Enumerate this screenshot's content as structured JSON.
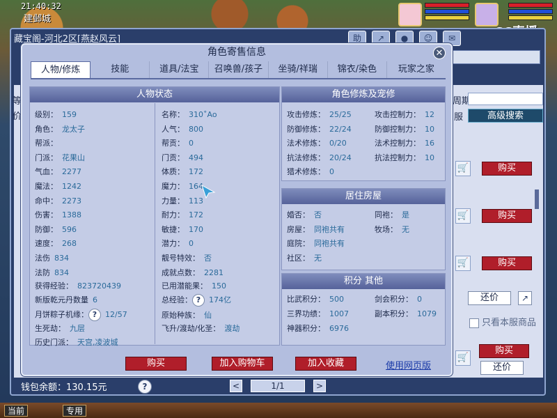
{
  "hud": {
    "time": "21:40:32",
    "city": "建邺城",
    "stream_logo": "CC直播"
  },
  "back_window": {
    "title": "藏宝阁-河北2区[燕赵风云]",
    "tools": [
      "助",
      "↗",
      "●",
      "☺",
      "✉"
    ],
    "labels": {
      "left_a": "等",
      "left_b": "价",
      "period": "周期",
      "server": "服"
    },
    "advanced_search": "高级搜索",
    "buy_label": "购买",
    "haggle_label": "还价",
    "only_this_server": "只看本服商品",
    "wallet_label": "钱包余额：",
    "wallet_value": "130.15元",
    "page": "1/1",
    "prev": "<",
    "next": ">"
  },
  "taskbar": {
    "current": "当前",
    "exclusive": "专用"
  },
  "dialog": {
    "title": "角色寄售信息",
    "close": "✕",
    "tabs": [
      "人物/修炼",
      "技能",
      "道具/法宝",
      "召唤兽/孩子",
      "坐骑/祥瑞",
      "锦衣/染色",
      "玩家之家"
    ],
    "active_tab": "人物/修炼",
    "status": {
      "header": "人物状态",
      "left": [
        {
          "label": "级别：",
          "value": "159"
        },
        {
          "label": "角色：",
          "value": "龙太子"
        },
        {
          "label": "帮派：",
          "value": ""
        },
        {
          "label": "门派：",
          "value": "花果山"
        },
        {
          "label": "气血：",
          "value": "2277"
        },
        {
          "label": "魔法：",
          "value": "1242"
        },
        {
          "label": "命中：",
          "value": "2273"
        },
        {
          "label": "伤害：",
          "value": "1388"
        },
        {
          "label": "防御：",
          "value": "596"
        },
        {
          "label": "速度：",
          "value": "268"
        },
        {
          "label": "法伤",
          "value": "834"
        },
        {
          "label": "法防",
          "value": "834"
        }
      ],
      "right": [
        {
          "label": "名称：",
          "value": "310˚Ao"
        },
        {
          "label": "人气：",
          "value": "800"
        },
        {
          "label": "帮贡：",
          "value": "0"
        },
        {
          "label": "门贡：",
          "value": "494"
        },
        {
          "label": "体质：",
          "value": "172"
        },
        {
          "label": "魔力：",
          "value": "164"
        },
        {
          "label": "力量：",
          "value": "113"
        },
        {
          "label": "耐力：",
          "value": "172"
        },
        {
          "label": "敏捷：",
          "value": "170"
        },
        {
          "label": "潜力：",
          "value": "0"
        },
        {
          "label": "靓号特效：",
          "value": "否"
        },
        {
          "label": "成就点数：",
          "value": "2281"
        }
      ],
      "extra": [
        {
          "label": "获得经验：",
          "value": "823720439"
        },
        {
          "label": "已用潜能果：",
          "value": "150"
        },
        {
          "label": "新版乾元丹数量",
          "value": "6"
        },
        {
          "label": "总经验：",
          "value": "174亿"
        },
        {
          "label": "月饼粽子机缘：",
          "value": "12/57"
        },
        {
          "label": "原始种族：",
          "value": "仙"
        },
        {
          "label": "生死劫：",
          "value": "九层"
        },
        {
          "label": "飞升/渡劫/化圣：",
          "value": "渡劫"
        },
        {
          "label": "历史门派：",
          "value": "天宫,凌波城"
        }
      ]
    },
    "cultivation": {
      "header": "角色修炼及宠修",
      "rows": [
        {
          "l_label": "攻击修炼：",
          "l_value": "25/25",
          "r_label": "攻击控制力：",
          "r_value": "12"
        },
        {
          "l_label": "防御修炼：",
          "l_value": "22/24",
          "r_label": "防御控制力：",
          "r_value": "10"
        },
        {
          "l_label": "法术修炼：",
          "l_value": "0/20",
          "r_label": "法术控制力：",
          "r_value": "16"
        },
        {
          "l_label": "抗法修炼：",
          "l_value": "20/24",
          "r_label": "抗法控制力：",
          "r_value": "10"
        },
        {
          "l_label": "猎术修炼：",
          "l_value": "0",
          "r_label": "",
          "r_value": ""
        }
      ]
    },
    "housing": {
      "header": "居住房屋",
      "rows": [
        {
          "l_label": "婚否：",
          "l_value": "否",
          "r_label": "同袍：",
          "r_value": "是"
        },
        {
          "l_label": "房屋：",
          "l_value": "同袍共有",
          "r_label": "牧场：",
          "r_value": "无"
        },
        {
          "l_label": "庭院：",
          "l_value": "同袍共有",
          "r_label": "",
          "r_value": ""
        },
        {
          "l_label": "社区：",
          "l_value": "无",
          "r_label": "",
          "r_value": ""
        }
      ]
    },
    "points": {
      "header": "积分 其他",
      "rows": [
        {
          "l_label": "比武积分：",
          "l_value": "500",
          "r_label": "剑会积分：",
          "r_value": "0"
        },
        {
          "l_label": "三界功绩：",
          "l_value": "1007",
          "r_label": "副本积分：",
          "r_value": "1079"
        },
        {
          "l_label": "神器积分：",
          "l_value": "6976",
          "r_label": "",
          "r_value": ""
        }
      ]
    },
    "actions": {
      "buy": "购买",
      "add_cart": "加入购物车",
      "add_fav": "加入收藏",
      "web": "使用网页版"
    }
  },
  "colors": {
    "accent_red": "#b01e2a",
    "value_blue": "#2a6a9a",
    "panel_header": "#55629a"
  }
}
